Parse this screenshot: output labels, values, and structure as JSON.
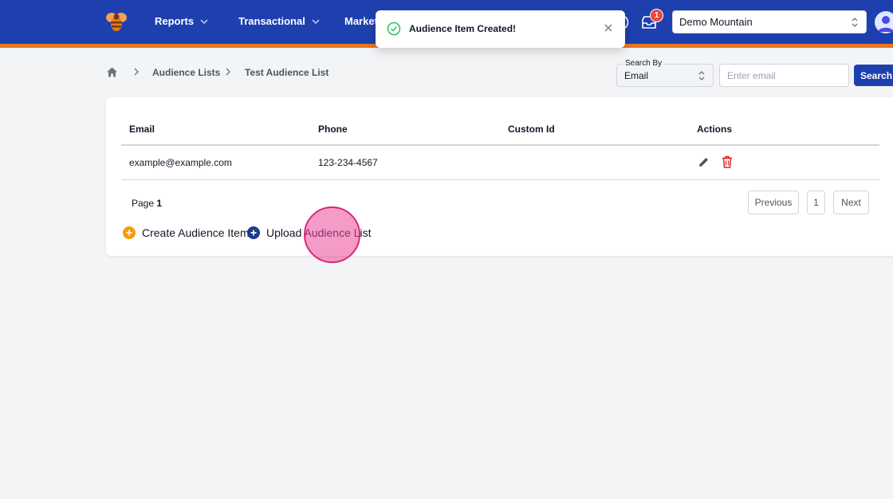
{
  "nav": {
    "items": [
      {
        "label": "Reports"
      },
      {
        "label": "Transactional"
      },
      {
        "label": "Marketi"
      }
    ],
    "badge_count": "1",
    "org_select_value": "Demo Mountain"
  },
  "toast": {
    "message": "Audience Item Created!"
  },
  "breadcrumb": {
    "items": [
      "Audience Lists",
      "Test Audience List"
    ]
  },
  "search": {
    "search_by_label": "Search By",
    "search_by_value": "Email",
    "placeholder": "Enter email",
    "button_label": "Search"
  },
  "table": {
    "headers": [
      "Email",
      "Phone",
      "Custom Id",
      "Actions"
    ],
    "rows": [
      {
        "email": "example@example.com",
        "phone": "123-234-4567",
        "custom_id": ""
      }
    ]
  },
  "pagination": {
    "page_prefix": "Page",
    "current_page": "1",
    "previous_label": "Previous",
    "page_button": "1",
    "next_label": "Next"
  },
  "actions": {
    "create_label": "Create Audience Item",
    "upload_label": "Upload Audience List"
  },
  "colors": {
    "nav_bg": "#1e40af",
    "nav_accent": "#e8771f",
    "create_icon": "#f59e0b",
    "upload_icon": "#1e3a8a",
    "delete_icon": "#dc2626",
    "success_icon": "#22c55e"
  },
  "icons": [
    "bee-logo-icon",
    "chevron-down-icon",
    "help-icon",
    "inbox-icon",
    "updown-icon",
    "avatar-icon",
    "check-circle-icon",
    "close-icon",
    "home-icon",
    "chevron-right-icon",
    "pencil-icon",
    "trash-icon",
    "plus-circle-icon"
  ]
}
